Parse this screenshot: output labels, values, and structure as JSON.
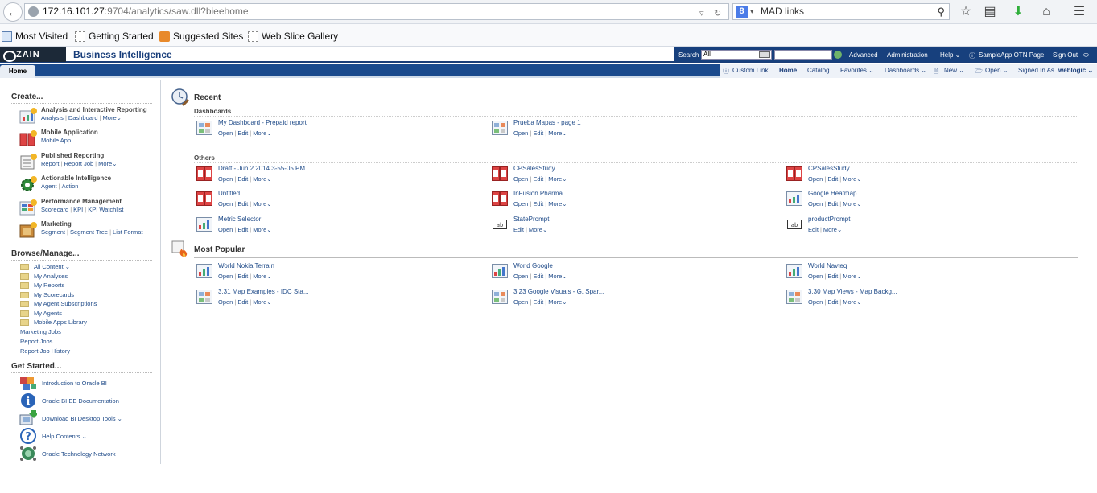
{
  "browser": {
    "url_host": "172.16.101.27",
    "url_rest": ":9704/analytics/saw.dll?bieehome",
    "search_value": "MAD links",
    "bookmarks": [
      "Most Visited",
      "Getting Started",
      "Suggested Sites",
      "Web Slice Gallery"
    ]
  },
  "header": {
    "logo": "ZAIN",
    "app_title": "Business Intelligence",
    "search_label": "Search",
    "search_scope": "All",
    "links": [
      "Advanced",
      "Administration",
      "Help ⌄",
      "SampleApp OTN Page",
      "Sign Out"
    ]
  },
  "tabbar": {
    "home_tab": "Home",
    "links": [
      "Custom Link",
      "Home",
      "Catalog",
      "Favorites ⌄",
      "Dashboards ⌄",
      "New ⌄",
      "Open ⌄"
    ],
    "signed_in_label": "Signed In As",
    "signed_in_user": "weblogic ⌄"
  },
  "sidebar": {
    "create_title": "Create...",
    "create_items": [
      {
        "title": "Analysis and Interactive Reporting",
        "links": [
          "Analysis",
          "Dashboard",
          "More⌄"
        ]
      },
      {
        "title": "Mobile Application",
        "links": [
          "Mobile App"
        ]
      },
      {
        "title": "Published Reporting",
        "links": [
          "Report",
          "Report Job",
          "More⌄"
        ]
      },
      {
        "title": "Actionable Intelligence",
        "links": [
          "Agent",
          "Action"
        ]
      },
      {
        "title": "Performance Management",
        "links": [
          "Scorecard",
          "KPI",
          "KPI Watchlist"
        ]
      },
      {
        "title": "Marketing",
        "links": [
          "Segment",
          "Segment Tree",
          "List Format"
        ]
      }
    ],
    "browse_title": "Browse/Manage...",
    "browse_items": [
      "All Content ⌄",
      "My Analyses",
      "My Reports",
      "My Scorecards",
      "My Agent Subscriptions",
      "My Agents",
      "Mobile Apps Library"
    ],
    "browse_plain": [
      "Marketing Jobs",
      "Report Jobs",
      "Report Job History"
    ],
    "getstarted_title": "Get Started...",
    "getstarted_items": [
      "Introduction to Oracle BI",
      "Oracle BI EE Documentation",
      "Download BI Desktop Tools ⌄",
      "Help Contents ⌄",
      "Oracle Technology Network"
    ]
  },
  "main": {
    "recent_title": "Recent",
    "dashboards_label": "Dashboards",
    "dashboards": [
      {
        "name": "My Dashboard - Prepaid report",
        "acts": [
          "Open",
          "Edit",
          "More⌄"
        ]
      },
      {
        "name": "Prueba Mapas - page 1",
        "acts": [
          "Open",
          "Edit",
          "More⌄"
        ]
      }
    ],
    "others_label": "Others",
    "others": [
      {
        "name": "Draft - Jun 2 2014 3-55-05 PM",
        "acts": [
          "Open",
          "Edit",
          "More⌄"
        ]
      },
      {
        "name": "CPSalesStudy",
        "acts": [
          "Open",
          "Edit",
          "More⌄"
        ]
      },
      {
        "name": "CPSalesStudy",
        "acts": [
          "Open",
          "Edit",
          "More⌄"
        ]
      },
      {
        "name": "Untitled",
        "acts": [
          "Open",
          "Edit",
          "More⌄"
        ]
      },
      {
        "name": "InFusion Pharma",
        "acts": [
          "Open",
          "Edit",
          "More⌄"
        ]
      },
      {
        "name": "Google Heatmap",
        "acts": [
          "Open",
          "Edit",
          "More⌄"
        ]
      },
      {
        "name": "Metric Selector",
        "acts": [
          "Open",
          "Edit",
          "More⌄"
        ]
      },
      {
        "name": "StatePrompt",
        "acts": [
          "Edit",
          "More⌄"
        ]
      },
      {
        "name": "productPrompt",
        "acts": [
          "Edit",
          "More⌄"
        ]
      }
    ],
    "popular_title": "Most Popular",
    "popular": [
      {
        "name": "World Nokia Terrain",
        "acts": [
          "Open",
          "Edit",
          "More⌄"
        ]
      },
      {
        "name": "World Google",
        "acts": [
          "Open",
          "Edit",
          "More⌄"
        ]
      },
      {
        "name": "World Navteq",
        "acts": [
          "Open",
          "Edit",
          "More⌄"
        ]
      },
      {
        "name": "3.31 Map Examples - IDC Sta...",
        "acts": [
          "Open",
          "Edit",
          "More⌄"
        ]
      },
      {
        "name": "3.23 Google Visuals - G. Spar...",
        "acts": [
          "Open",
          "Edit",
          "More⌄"
        ]
      },
      {
        "name": "3.30 Map Views - Map Backg...",
        "acts": [
          "Open",
          "Edit",
          "More⌄"
        ]
      }
    ]
  }
}
